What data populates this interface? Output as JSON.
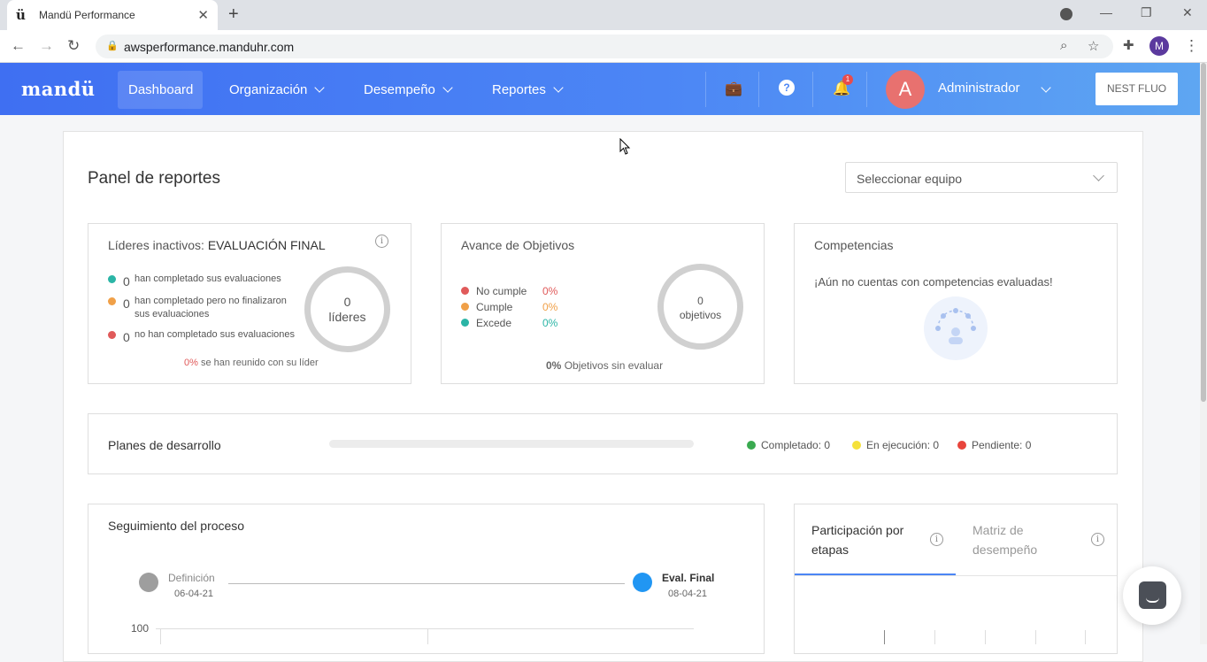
{
  "browser": {
    "tab_title": "Mandü Performance",
    "tab_favicon": "ü",
    "url": "awsperformance.manduhr.com",
    "profile_initial": "M"
  },
  "header": {
    "logo": "mandü",
    "nav": [
      {
        "label": "Dashboard"
      },
      {
        "label": "Organización"
      },
      {
        "label": "Desempeño"
      },
      {
        "label": "Reportes"
      }
    ],
    "notification_count": "1",
    "avatar_initial": "A",
    "user_name": "Administrador",
    "nest_button": "NEST FLUO"
  },
  "main": {
    "title": "Panel de reportes",
    "team_select": {
      "placeholder": "Seleccionar equipo"
    }
  },
  "leaders_card": {
    "title_prefix": "Líderes inactivos:",
    "title_main": "EVALUACIÓN FINAL",
    "rows": [
      {
        "count": "0",
        "text": "han completado sus evaluaciones",
        "color": "#2bb5a6"
      },
      {
        "count": "0",
        "text": "han completado pero no finalizaron sus evaluaciones",
        "color": "#f0a048"
      },
      {
        "count": "0",
        "text": "no han completado sus evaluaciones",
        "color": "#e05a5a"
      }
    ],
    "ring_value": "0",
    "ring_label": "líderes",
    "footer_pct": "0%",
    "footer_text": "se han reunido con su líder"
  },
  "objectives_card": {
    "title": "Avance de Objetivos",
    "rows": [
      {
        "label": "No cumple",
        "pct": "0%",
        "color": "#e05a5a"
      },
      {
        "label": "Cumple",
        "pct": "0%",
        "color": "#f0a048"
      },
      {
        "label": "Excede",
        "pct": "0%",
        "color": "#2bb5a6"
      }
    ],
    "ring_value": "0",
    "ring_label": "objetivos",
    "footer_pct": "0%",
    "footer_text": "Objetivos sin evaluar"
  },
  "competencies_card": {
    "title": "Competencias",
    "message": "¡Aún no cuentas con competencias evaluadas!"
  },
  "development_plans": {
    "title": "Planes de desarrollo",
    "progress": 0,
    "legend": [
      {
        "label": "Completado: 0",
        "color": "#3aaa50"
      },
      {
        "label": "En ejecución: 0",
        "color": "#f5e13a"
      },
      {
        "label": "Pendiente: 0",
        "color": "#e8453c"
      }
    ]
  },
  "process": {
    "title": "Seguimiento del proceso",
    "stages": [
      {
        "label": "Definición",
        "date": "06-04-21",
        "color": "#9e9e9e"
      },
      {
        "label": "Eval. Final",
        "date": "08-04-21",
        "color": "#2196f3"
      }
    ],
    "y_tick": "100"
  },
  "participation": {
    "tabs": [
      {
        "label": "Participación por etapas"
      },
      {
        "label": "Matriz de desempeño"
      }
    ]
  }
}
